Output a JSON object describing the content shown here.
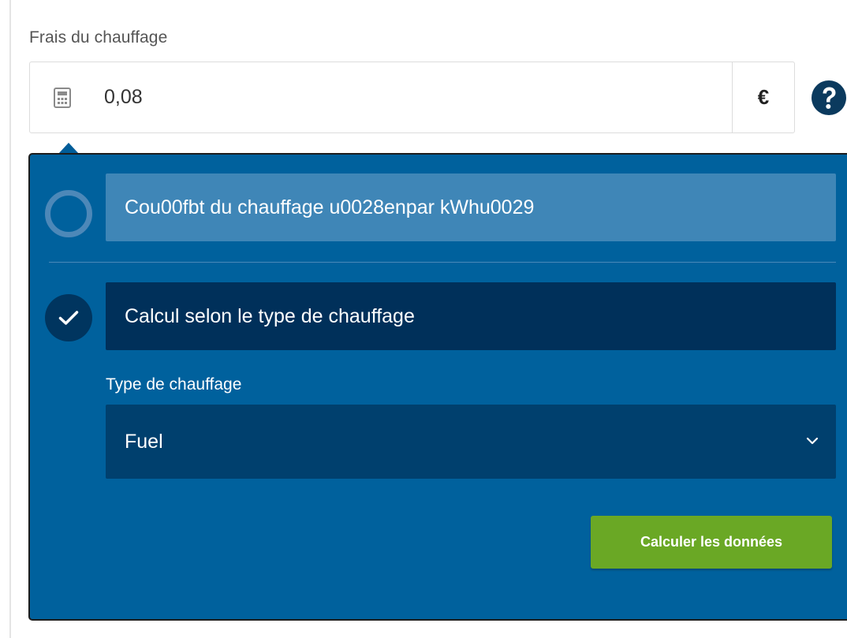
{
  "field": {
    "label": "Frais du chauffage",
    "value": "0,08",
    "currency": "€",
    "calc_icon": "calculator-icon",
    "help_icon": "question-circle-icon"
  },
  "panel": {
    "options": [
      {
        "label": "Cou00fbt du chauffage u0028enpar kWhu0029",
        "selected": false
      },
      {
        "label": "Calcul selon le type de chauffage",
        "selected": true
      }
    ],
    "heating_type": {
      "label": "Type de chauffage",
      "selected": "Fuel"
    },
    "button_label": "Calculer les données"
  },
  "colors": {
    "panel_bg": "#00619d",
    "option_unselected_bg": "#3f86b7",
    "option_selected_bg": "#00305a",
    "select_bg": "#00406e",
    "button_bg": "#6aa825",
    "help_icon": "#0b3a5e"
  }
}
